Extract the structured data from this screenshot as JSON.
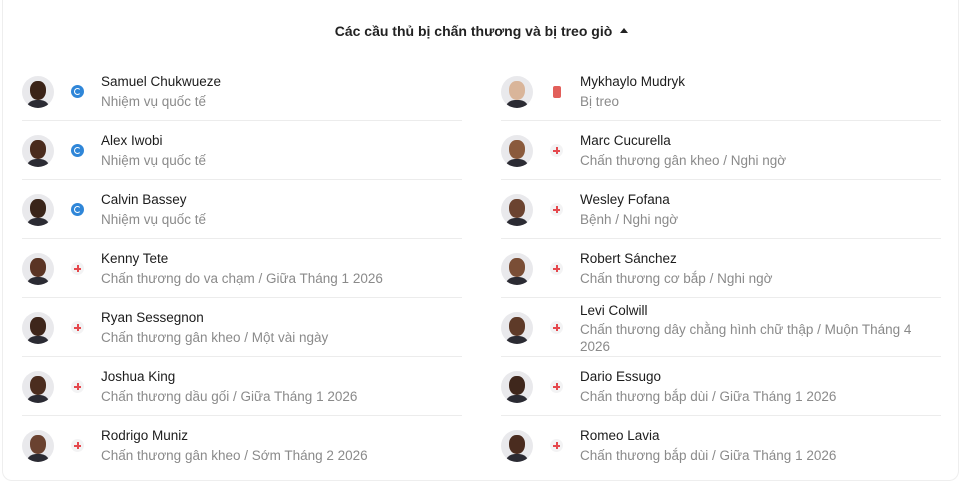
{
  "header": {
    "title": "Các cầu thủ bị chấn thương và bị treo giò"
  },
  "colors": {
    "globe": "#2f86d8",
    "injury": "#e5484d",
    "suspension": "#e25f5a"
  },
  "left": [
    {
      "name": "Samuel Chukwueze",
      "detail": "Nhiệm vụ quốc tế",
      "icon": "globe-icon",
      "skin": "#3b2418"
    },
    {
      "name": "Alex Iwobi",
      "detail": "Nhiệm vụ quốc tế",
      "icon": "globe-icon",
      "skin": "#4a2b1d"
    },
    {
      "name": "Calvin Bassey",
      "detail": "Nhiệm vụ quốc tế",
      "icon": "globe-icon",
      "skin": "#3a251a"
    },
    {
      "name": "Kenny Tete",
      "detail": "Chấn thương do va chạm / Giữa Tháng 1 2026",
      "icon": "injury-icon",
      "skin": "#5a3424"
    },
    {
      "name": "Ryan Sessegnon",
      "detail": "Chấn thương gân kheo / Một vài ngày",
      "icon": "injury-icon",
      "skin": "#3e261b"
    },
    {
      "name": "Joshua King",
      "detail": "Chấn thương dầu gối / Giữa Tháng 1 2026",
      "icon": "injury-icon",
      "skin": "#4b2d1f"
    },
    {
      "name": "Rodrigo Muniz",
      "detail": "Chấn thương gân kheo / Sớm Tháng 2 2026",
      "icon": "injury-icon",
      "skin": "#6a4230"
    }
  ],
  "right": [
    {
      "name": "Mykhaylo Mudryk",
      "detail": "Bị treo",
      "icon": "red-card-icon",
      "skin": "#d9b59a"
    },
    {
      "name": "Marc Cucurella",
      "detail": "Chấn thương gân kheo / Nghi ngờ",
      "icon": "injury-icon",
      "skin": "#8a5a3c"
    },
    {
      "name": "Wesley Fofana",
      "detail": "Bệnh / Nghi ngờ",
      "icon": "injury-icon",
      "skin": "#6b4330"
    },
    {
      "name": "Robert Sánchez",
      "detail": "Chấn thương cơ bắp / Nghi ngờ",
      "icon": "injury-icon",
      "skin": "#7a4e36"
    },
    {
      "name": "Levi Colwill",
      "detail": "Chấn thương dây chằng hình chữ thập / Muộn Tháng 4 2026",
      "icon": "injury-icon",
      "skin": "#5e3a28"
    },
    {
      "name": "Dario Essugo",
      "detail": "Chấn thương bắp dùi / Giữa Tháng 1 2026",
      "icon": "injury-icon",
      "skin": "#3f271c"
    },
    {
      "name": "Romeo Lavia",
      "detail": "Chấn thương bắp dùi / Giữa Tháng 1 2026",
      "icon": "injury-icon",
      "skin": "#4a2c1f"
    }
  ]
}
